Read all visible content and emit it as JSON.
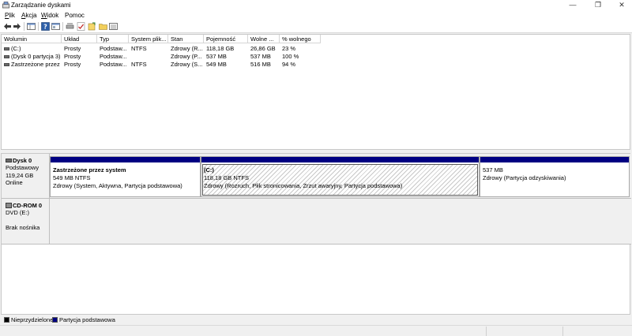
{
  "window": {
    "title": "Zarządzanie dyskami",
    "app_icon": "disk-management-icon"
  },
  "window_controls": {
    "minimize": "—",
    "maximize": "❐",
    "close": "✕"
  },
  "menu": [
    {
      "label": "Plik",
      "accel": "P",
      "rest": "lik"
    },
    {
      "label": "Akcja",
      "accel": "A",
      "rest": "kcja"
    },
    {
      "label": "Widok",
      "accel": "W",
      "rest": "idok"
    },
    {
      "label": "Pomoc",
      "accel": "",
      "rest": "Pomoc"
    }
  ],
  "toolbar": [
    "back-arrow-icon",
    "forward-arrow-icon",
    "show-hide-console-tree-icon",
    "help-icon",
    "properties-icon",
    "connect-drive-icon",
    "checkmark-icon",
    "rescan-disks-icon",
    "folder-icon",
    "details-view-icon"
  ],
  "volumes": {
    "columns": [
      "Wolumin",
      "Układ",
      "Typ",
      "System plik...",
      "Stan",
      "Pojemność",
      "Wolne ...",
      "% wolnego"
    ],
    "rows": [
      [
        "(C:)",
        "Prosty",
        "Podstaw...",
        "NTFS",
        "Zdrowy (R...",
        "118,18 GB",
        "26,86 GB",
        "23 %"
      ],
      [
        "(Dysk 0 partycja 3)",
        "Prosty",
        "Podstaw...",
        "",
        "Zdrowy (P...",
        "537 MB",
        "537 MB",
        "100 %"
      ],
      [
        "Zastrzeżone przez ...",
        "Prosty",
        "Podstaw...",
        "NTFS",
        "Zdrowy (S...",
        "549 MB",
        "516 MB",
        "94 %"
      ]
    ]
  },
  "disks": [
    {
      "name": "Dysk 0",
      "type": "Podstawowy",
      "size": "119,24 GB",
      "status": "Online",
      "partitions": [
        {
          "name": "Zastrzeżone przez system",
          "size": "549 MB NTFS",
          "status": "Zdrowy (System, Aktywna, Partycja podstawowa)",
          "selected": false
        },
        {
          "name": "(C:)",
          "size": "118,18 GB NTFS",
          "status": "Zdrowy (Rozruch, Plik stronicowania, Zrzut awaryjny, Partycja podstawowa)",
          "selected": true
        },
        {
          "name": "",
          "size": "537 MB",
          "status": "Zdrowy (Partycja odzyskiwania)",
          "selected": false
        }
      ]
    },
    {
      "name": "CD-ROM 0",
      "type": "DVD (E:)",
      "size": "",
      "status": "Brak nośnika"
    }
  ],
  "legend": [
    {
      "label": "Nieprzydzielone",
      "color": "#000000"
    },
    {
      "label": "Partycja podstawowa",
      "color": "#000082"
    }
  ],
  "colors": {
    "partition_header": "#000082",
    "unallocated": "#000000"
  }
}
